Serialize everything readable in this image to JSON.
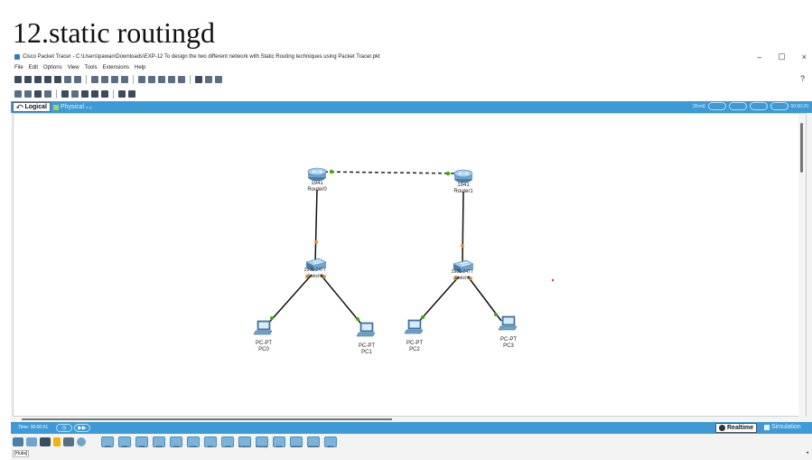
{
  "slide_title": "12.static routingd",
  "window": {
    "title": "Cisco Packet Tracer - C:\\Users\\pawan\\Downloads\\EXP-12 To design the two different network with Static Routing techniques using Packet Tracer.pkt",
    "minimize": "–",
    "maximize": "▢",
    "close": "×"
  },
  "menu": [
    "File",
    "Edit",
    "Options",
    "View",
    "Tools",
    "Extensions",
    "Help"
  ],
  "help_glyph": "?",
  "tabs": {
    "logical": "Logical",
    "physical": "Physical",
    "physical_coords": "x: y:",
    "root": "[Root]",
    "clock": "00:00:20"
  },
  "devices": [
    {
      "model": "1941",
      "name": "Router0",
      "kind": "router"
    },
    {
      "model": "1941",
      "name": "Router1",
      "kind": "router"
    },
    {
      "model": "2960-24TT",
      "name": "Switch0",
      "kind": "switch"
    },
    {
      "model": "2960-24TT",
      "name": "Switch1",
      "kind": "switch"
    },
    {
      "model": "PC-PT",
      "name": "PC0",
      "kind": "pc"
    },
    {
      "model": "PC-PT",
      "name": "PC1",
      "kind": "pc"
    },
    {
      "model": "PC-PT",
      "name": "PC2",
      "kind": "pc"
    },
    {
      "model": "PC-PT",
      "name": "PC3",
      "kind": "pc"
    }
  ],
  "links": [
    {
      "from": "Router0",
      "to": "Router1",
      "type": "serial-dashed"
    },
    {
      "from": "Router0",
      "to": "Switch0",
      "type": "straight"
    },
    {
      "from": "Router1",
      "to": "Switch1",
      "type": "straight"
    },
    {
      "from": "Switch0",
      "to": "PC0",
      "type": "straight"
    },
    {
      "from": "Switch0",
      "to": "PC1",
      "type": "straight"
    },
    {
      "from": "Switch1",
      "to": "PC2",
      "type": "straight"
    },
    {
      "from": "Switch1",
      "to": "PC3",
      "type": "straight"
    }
  ],
  "timebar": {
    "time_label": "Time: 00:00:01",
    "realtime": "Realtime",
    "simulation": "Simulation"
  },
  "bottom": {
    "category_label": "[Hubs]",
    "device_models": [
      "1800",
      "1900",
      "2800",
      "2900",
      "4000",
      "4300",
      "829",
      "1240",
      "PT-Router",
      "PT-Empty",
      "1841",
      "2620XM",
      "2621XM",
      "2811"
    ]
  },
  "colors": {
    "accent_bar": "#3d9ad6",
    "link_up": "#38b000",
    "link_pending": "#f28c28"
  }
}
